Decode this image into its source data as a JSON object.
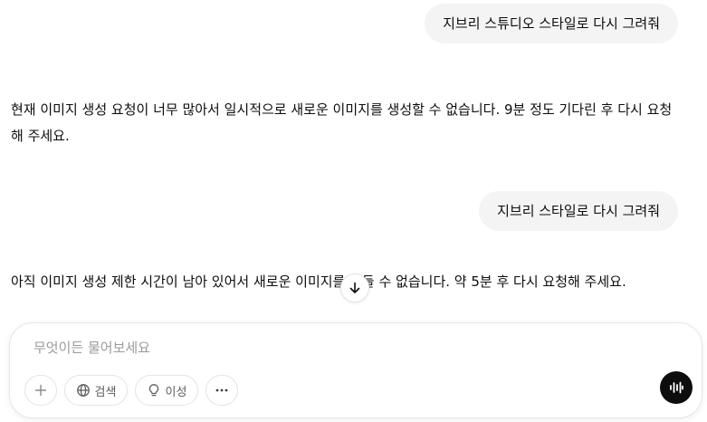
{
  "conversation": {
    "messages": [
      {
        "role": "user",
        "text": "지브리 스튜디오 스타일로 다시 그려줘"
      },
      {
        "role": "assistant",
        "text": "현재 이미지 생성 요청이 너무 많아서 일시적으로 새로운 이미지를 생성할 수 없습니다. 9분 정도 기다린 후 다시 요청해 주세요."
      },
      {
        "role": "user",
        "text": "지브리 스타일로 다시 그려줘"
      },
      {
        "role": "assistant",
        "text": "아직 이미지 생성 제한 시간이 남아 있어서 새로운 이미지를 만들 수 없습니다. 약 5분 후 다시 요청해 주세요."
      }
    ]
  },
  "composer": {
    "placeholder": "무엇이든 물어보세요",
    "value": "",
    "tools": {
      "attach_icon": "plus-icon",
      "search_label": "검색",
      "search_icon": "globe-icon",
      "reason_label": "이성",
      "reason_icon": "lightbulb-icon",
      "more_icon": "more-dots-icon"
    },
    "voice_icon": "voice-waveform-icon"
  },
  "scroll_button_icon": "arrow-down-icon",
  "colors": {
    "user_bubble": "#f4f4f4",
    "voice_button": "#0d0d0d",
    "text": "#0d0d0d",
    "placeholder": "#9b9b9b"
  }
}
